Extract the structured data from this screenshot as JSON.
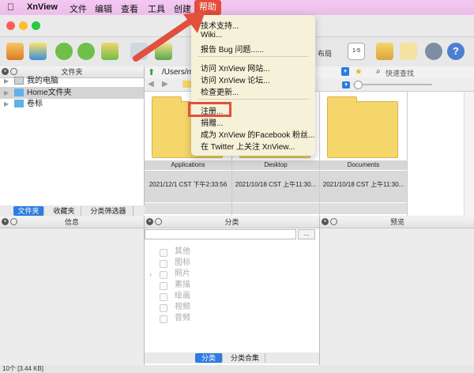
{
  "menubar": {
    "app_name": "XnView",
    "items": [
      "文件",
      "编辑",
      "查看",
      "工具",
      "创建",
      "帮助"
    ],
    "active": "帮助"
  },
  "help_menu": {
    "group1": [
      "技术支持...",
      "Wiki...",
      "报告 Bug 问题......"
    ],
    "group2": [
      "访问 XnView 网站...",
      "访问 XnView 论坛...",
      "检查更新..."
    ],
    "group3": [
      "注册...",
      "捐赠...",
      "成为 XnView 的Facebook 粉丝...",
      "在 Twitter 上关注 XnView..."
    ],
    "highlighted": "注册..."
  },
  "toolbar": {
    "layout_label": "布局",
    "page_badge": "1-5"
  },
  "folder_panel": {
    "title": "文件夹",
    "items": [
      {
        "label": "我的电脑",
        "icon": "computer-icon",
        "selected": false
      },
      {
        "label": "Home文件夹",
        "icon": "home-folder-icon",
        "selected": true
      },
      {
        "label": "卷标",
        "icon": "volume-icon",
        "selected": false
      }
    ],
    "tabs": [
      "文件夹",
      "收藏夹",
      "分类筛选器"
    ],
    "active_tab": "文件夹"
  },
  "browser": {
    "path": "/Users/m",
    "search_placeholder": "快速查找",
    "thumbnails": [
      {
        "name": "Applications",
        "date": "2021/12/1 CST 下午2:33:56"
      },
      {
        "name": "Desktop",
        "date": "2021/10/18 CST 上午11:30..."
      },
      {
        "name": "Documents",
        "date": "2021/10/18 CST 上午11:30..."
      }
    ]
  },
  "info_panel": {
    "title": "信息"
  },
  "category_panel": {
    "title": "分类",
    "more_button": "...",
    "items": [
      "其他",
      "图标",
      "照片",
      "素描",
      "绘画",
      "视频",
      "音频"
    ],
    "expandable": "照片",
    "tabs": [
      "分类",
      "分类合集"
    ],
    "active_tab": "分类"
  },
  "preview_panel": {
    "title": "预览"
  },
  "status": {
    "text": "10个 [3.44 KB]"
  },
  "colors": {
    "menubar_bg": "#f0c4ee",
    "accent_blue": "#2d7ce0",
    "highlight_red": "#e0503d",
    "menu_bg": "#f6f1d9",
    "folder_yellow": "#f5d66b"
  }
}
